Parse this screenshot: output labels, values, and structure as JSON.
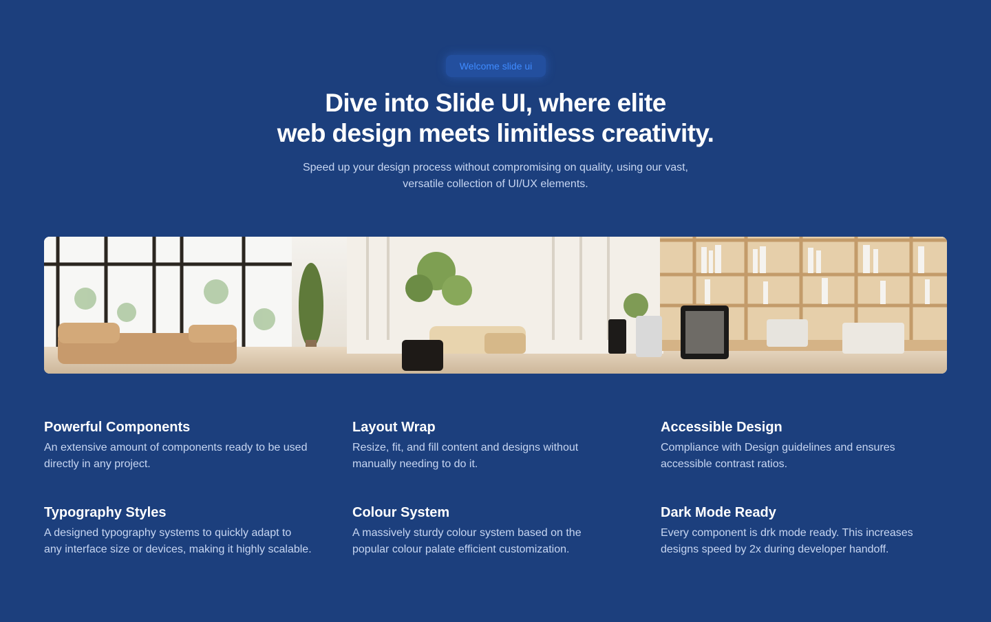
{
  "hero": {
    "badge": "Welcome slide ui",
    "headline_line1": "Dive into Slide UI, where elite",
    "headline_line2": "web design meets limitless creativity.",
    "subhead_line1": "Speed up your design process without compromising on quality, using our vast,",
    "subhead_line2": "versatile collection of UI/UX elements."
  },
  "banner": {
    "image": "office-interior-photo"
  },
  "features": [
    {
      "title": "Powerful Components",
      "desc_line1": "An extensive amount of components ready to be used",
      "desc_line2": "directly in any project."
    },
    {
      "title": "Layout Wrap",
      "desc_line1": "Resize, fit, and fill content and designs without",
      "desc_line2": "manually needing to do it."
    },
    {
      "title": "Accessible Design",
      "desc_line1": "Compliance with Design guidelines and ensures",
      "desc_line2": "accessible contrast ratios."
    },
    {
      "title": "Typography Styles",
      "desc_line1": "A designed typography systems to quickly adapt to",
      "desc_line2": "any interface size or devices, making it highly scalable."
    },
    {
      "title": "Colour System",
      "desc_line1": "A massively sturdy colour system based on the",
      "desc_line2": "popular colour palate efficient customization."
    },
    {
      "title": "Dark Mode Ready",
      "desc_line1": "Every component is drk mode ready. This increases",
      "desc_line2": "designs speed by 2x during developer handoff."
    }
  ],
  "colors": {
    "background": "#1c3f7d",
    "badge_bg": "#234f9e",
    "badge_text": "#3f8bff",
    "heading": "#ffffff",
    "body_text": "#c7d6f2"
  }
}
